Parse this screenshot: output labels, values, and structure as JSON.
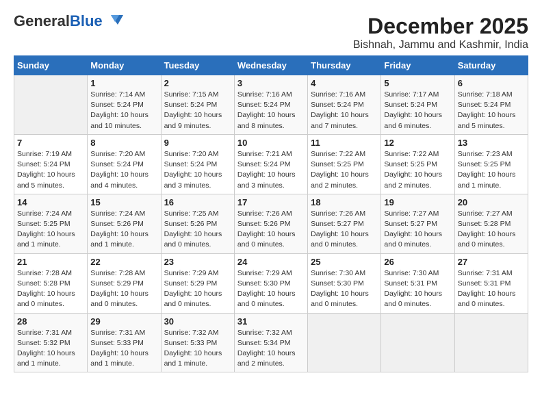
{
  "logo": {
    "part1": "General",
    "part2": "Blue"
  },
  "title": "December 2025",
  "subtitle": "Bishnah, Jammu and Kashmir, India",
  "days_of_week": [
    "Sunday",
    "Monday",
    "Tuesday",
    "Wednesday",
    "Thursday",
    "Friday",
    "Saturday"
  ],
  "weeks": [
    [
      {
        "day": "",
        "info": ""
      },
      {
        "day": "1",
        "info": "Sunrise: 7:14 AM\nSunset: 5:24 PM\nDaylight: 10 hours\nand 10 minutes."
      },
      {
        "day": "2",
        "info": "Sunrise: 7:15 AM\nSunset: 5:24 PM\nDaylight: 10 hours\nand 9 minutes."
      },
      {
        "day": "3",
        "info": "Sunrise: 7:16 AM\nSunset: 5:24 PM\nDaylight: 10 hours\nand 8 minutes."
      },
      {
        "day": "4",
        "info": "Sunrise: 7:16 AM\nSunset: 5:24 PM\nDaylight: 10 hours\nand 7 minutes."
      },
      {
        "day": "5",
        "info": "Sunrise: 7:17 AM\nSunset: 5:24 PM\nDaylight: 10 hours\nand 6 minutes."
      },
      {
        "day": "6",
        "info": "Sunrise: 7:18 AM\nSunset: 5:24 PM\nDaylight: 10 hours\nand 5 minutes."
      }
    ],
    [
      {
        "day": "7",
        "info": "Sunrise: 7:19 AM\nSunset: 5:24 PM\nDaylight: 10 hours\nand 5 minutes."
      },
      {
        "day": "8",
        "info": "Sunrise: 7:20 AM\nSunset: 5:24 PM\nDaylight: 10 hours\nand 4 minutes."
      },
      {
        "day": "9",
        "info": "Sunrise: 7:20 AM\nSunset: 5:24 PM\nDaylight: 10 hours\nand 3 minutes."
      },
      {
        "day": "10",
        "info": "Sunrise: 7:21 AM\nSunset: 5:24 PM\nDaylight: 10 hours\nand 3 minutes."
      },
      {
        "day": "11",
        "info": "Sunrise: 7:22 AM\nSunset: 5:25 PM\nDaylight: 10 hours\nand 2 minutes."
      },
      {
        "day": "12",
        "info": "Sunrise: 7:22 AM\nSunset: 5:25 PM\nDaylight: 10 hours\nand 2 minutes."
      },
      {
        "day": "13",
        "info": "Sunrise: 7:23 AM\nSunset: 5:25 PM\nDaylight: 10 hours\nand 1 minute."
      }
    ],
    [
      {
        "day": "14",
        "info": "Sunrise: 7:24 AM\nSunset: 5:25 PM\nDaylight: 10 hours\nand 1 minute."
      },
      {
        "day": "15",
        "info": "Sunrise: 7:24 AM\nSunset: 5:26 PM\nDaylight: 10 hours\nand 1 minute."
      },
      {
        "day": "16",
        "info": "Sunrise: 7:25 AM\nSunset: 5:26 PM\nDaylight: 10 hours\nand 0 minutes."
      },
      {
        "day": "17",
        "info": "Sunrise: 7:26 AM\nSunset: 5:26 PM\nDaylight: 10 hours\nand 0 minutes."
      },
      {
        "day": "18",
        "info": "Sunrise: 7:26 AM\nSunset: 5:27 PM\nDaylight: 10 hours\nand 0 minutes."
      },
      {
        "day": "19",
        "info": "Sunrise: 7:27 AM\nSunset: 5:27 PM\nDaylight: 10 hours\nand 0 minutes."
      },
      {
        "day": "20",
        "info": "Sunrise: 7:27 AM\nSunset: 5:28 PM\nDaylight: 10 hours\nand 0 minutes."
      }
    ],
    [
      {
        "day": "21",
        "info": "Sunrise: 7:28 AM\nSunset: 5:28 PM\nDaylight: 10 hours\nand 0 minutes."
      },
      {
        "day": "22",
        "info": "Sunrise: 7:28 AM\nSunset: 5:29 PM\nDaylight: 10 hours\nand 0 minutes."
      },
      {
        "day": "23",
        "info": "Sunrise: 7:29 AM\nSunset: 5:29 PM\nDaylight: 10 hours\nand 0 minutes."
      },
      {
        "day": "24",
        "info": "Sunrise: 7:29 AM\nSunset: 5:30 PM\nDaylight: 10 hours\nand 0 minutes."
      },
      {
        "day": "25",
        "info": "Sunrise: 7:30 AM\nSunset: 5:30 PM\nDaylight: 10 hours\nand 0 minutes."
      },
      {
        "day": "26",
        "info": "Sunrise: 7:30 AM\nSunset: 5:31 PM\nDaylight: 10 hours\nand 0 minutes."
      },
      {
        "day": "27",
        "info": "Sunrise: 7:31 AM\nSunset: 5:31 PM\nDaylight: 10 hours\nand 0 minutes."
      }
    ],
    [
      {
        "day": "28",
        "info": "Sunrise: 7:31 AM\nSunset: 5:32 PM\nDaylight: 10 hours\nand 1 minute."
      },
      {
        "day": "29",
        "info": "Sunrise: 7:31 AM\nSunset: 5:33 PM\nDaylight: 10 hours\nand 1 minute."
      },
      {
        "day": "30",
        "info": "Sunrise: 7:32 AM\nSunset: 5:33 PM\nDaylight: 10 hours\nand 1 minute."
      },
      {
        "day": "31",
        "info": "Sunrise: 7:32 AM\nSunset: 5:34 PM\nDaylight: 10 hours\nand 2 minutes."
      },
      {
        "day": "",
        "info": ""
      },
      {
        "day": "",
        "info": ""
      },
      {
        "day": "",
        "info": ""
      }
    ]
  ]
}
